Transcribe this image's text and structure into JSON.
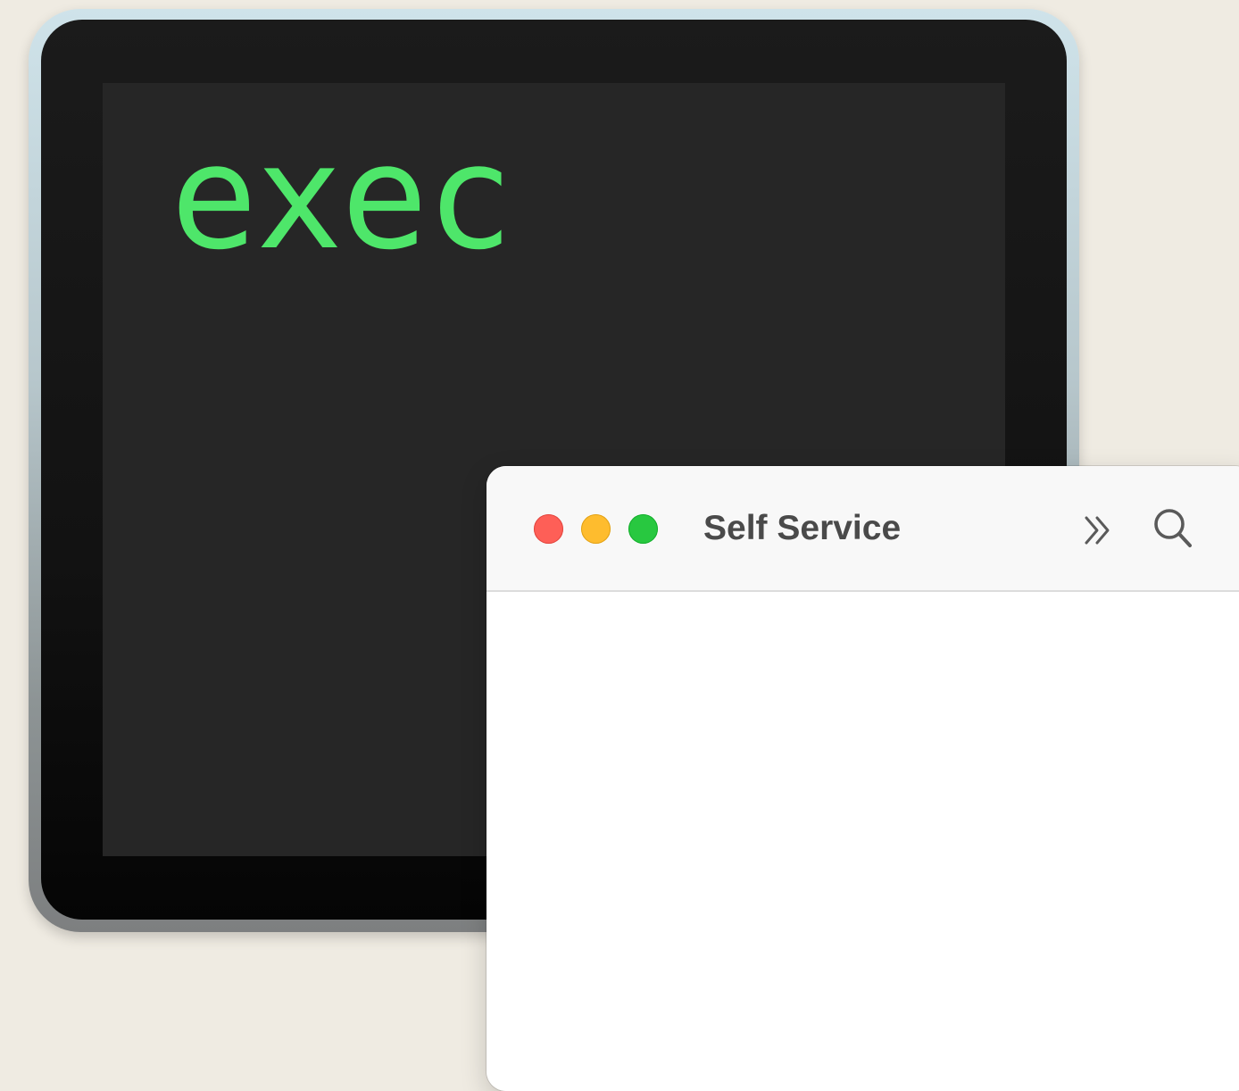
{
  "terminal_icon": {
    "screen_text": "exec",
    "text_color": "#4ee66a"
  },
  "self_service_window": {
    "title": "Self Service",
    "traffic_lights": {
      "close_color": "#fe5f57",
      "minimize_color": "#febc2e",
      "zoom_color": "#28c840"
    },
    "toolbar": {
      "overflow_icon": "chevron-double-right-icon",
      "search_icon": "search-icon"
    }
  },
  "desktop_background": "#efebe2"
}
